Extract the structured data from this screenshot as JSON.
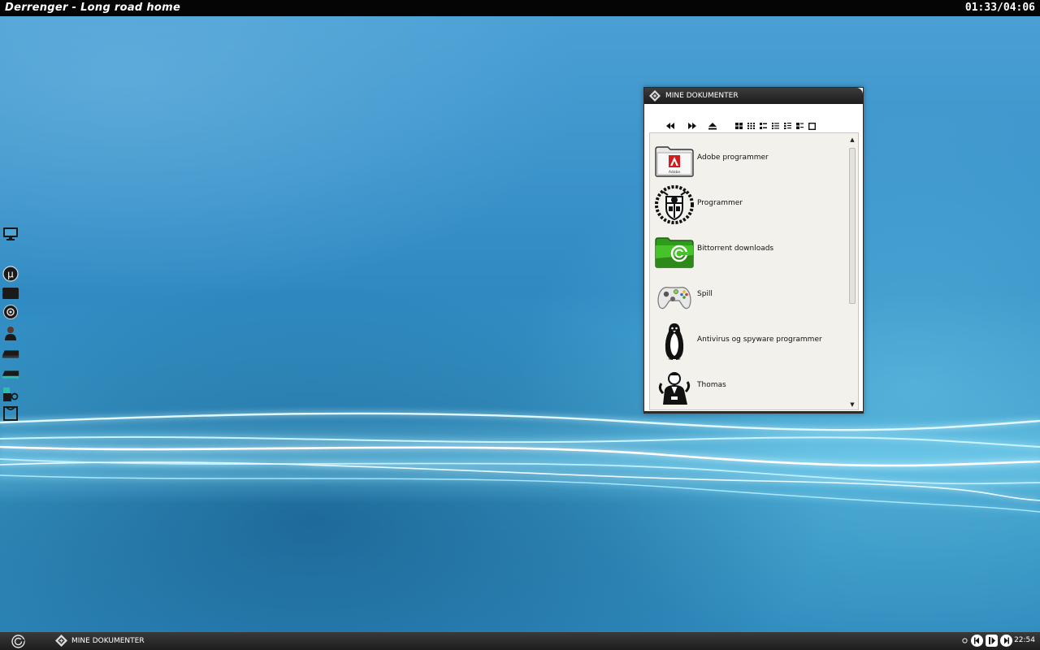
{
  "topbar": {
    "track": "Derrenger - Long road home",
    "time": "01:33/04:06"
  },
  "dock": {
    "icons": [
      "monitor-icon",
      "utorrent-icon",
      "folder-icon",
      "disc-icon",
      "user-icon",
      "drive-icon",
      "drive-icon",
      "shapes-icon",
      "bag-icon"
    ]
  },
  "window": {
    "title": "MINE DOKUMENTER",
    "toolbar": {
      "back_icon": "rewind-icon",
      "forward_icon": "fast-forward-icon",
      "up_icon": "up-arrow-icon",
      "view_icons": [
        "large-icons-view-icon",
        "small-icons-view-icon",
        "list-view-icon",
        "details-view-icon",
        "tiles-view-icon",
        "thumbnails-view-icon",
        "filmstrip-view-icon"
      ]
    },
    "items": [
      {
        "label": "Adobe programmer",
        "icon": "adobe-folder-icon"
      },
      {
        "label": "Programmer",
        "icon": "crest-icon"
      },
      {
        "label": "Bittorrent downloads",
        "icon": "bittorrent-folder-icon"
      },
      {
        "label": "Spill",
        "icon": "gamepad-icon"
      },
      {
        "label": "Antivirus og spyware programmer",
        "icon": "penguin-icon"
      },
      {
        "label": "Thomas",
        "icon": "portrait-icon"
      }
    ]
  },
  "taskbar": {
    "start_icon": "start-orb-icon",
    "task_label": "MINE DOKUMENTER",
    "clock": "22:54",
    "tray_icons": [
      "dot-icon",
      "previous-icon",
      "play-pause-icon",
      "next-icon"
    ]
  },
  "colors": {
    "wallpaper": "#2f8fc4",
    "bar": "#1d1d1d",
    "pane": "#f2f1ec"
  }
}
